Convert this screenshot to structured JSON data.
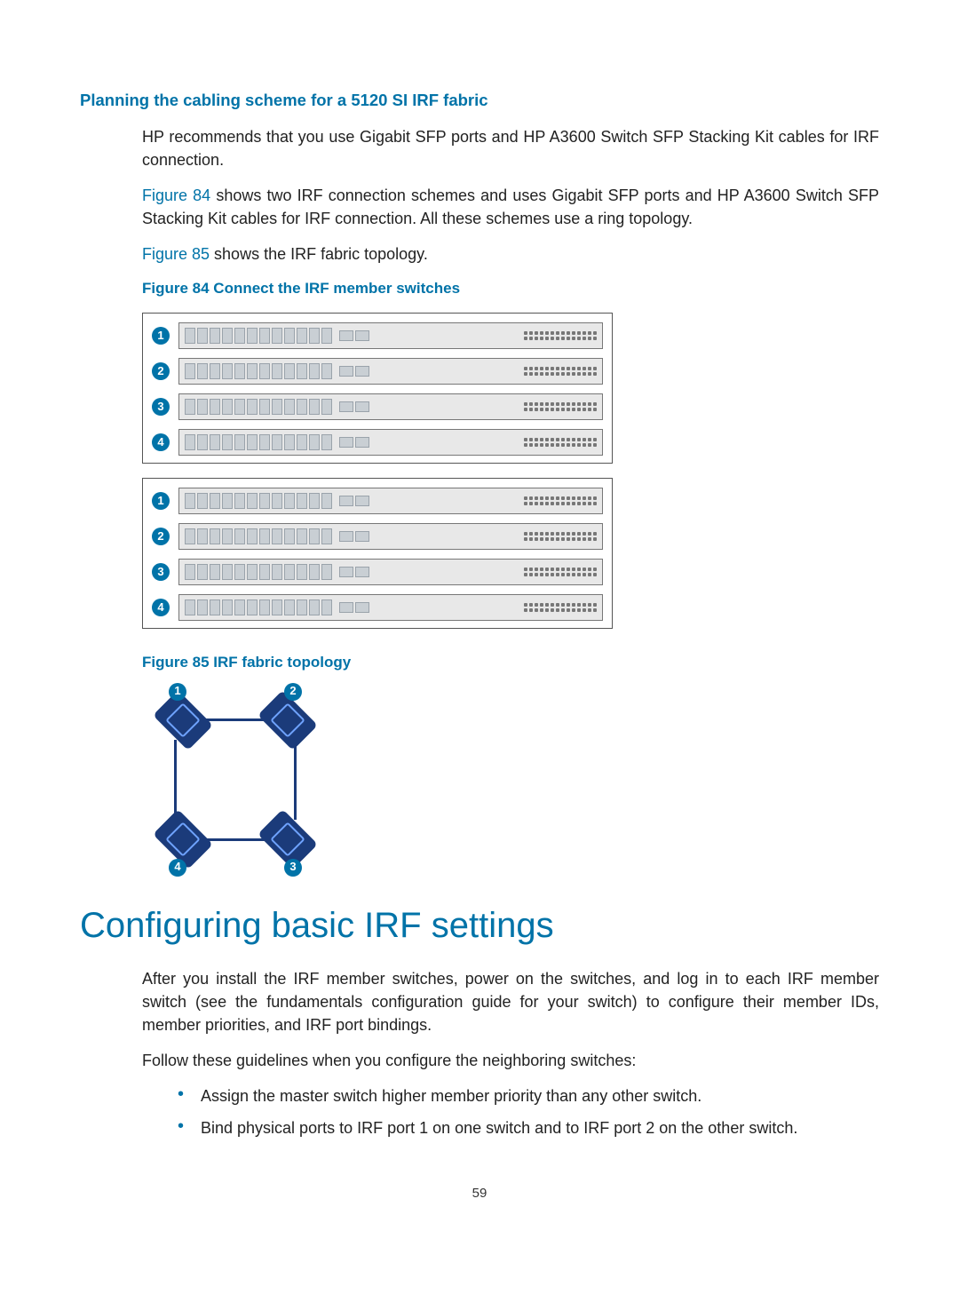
{
  "section": {
    "heading3": "Planning the cabling scheme for a 5120 SI IRF fabric",
    "para1": "HP recommends that you use Gigabit SFP ports and HP A3600 Switch SFP Stacking Kit cables for IRF connection.",
    "para2a": "Figure 84",
    "para2b": " shows two IRF connection schemes and uses Gigabit SFP ports and HP A3600 Switch SFP Stacking Kit cables for IRF connection. All these schemes use a ring topology.",
    "para3a": "Figure 85",
    "para3b": " shows the IRF fabric topology.",
    "fig84_caption": "Figure 84 Connect the IRF member switches",
    "fig84_labels": {
      "g1": [
        "1",
        "2",
        "3",
        "4"
      ],
      "g2": [
        "1",
        "2",
        "3",
        "4"
      ]
    },
    "fig85_caption": "Figure 85 IRF fabric topology",
    "fig85_labels": [
      "1",
      "2",
      "3",
      "4"
    ]
  },
  "section2": {
    "heading2": "Configuring basic IRF settings",
    "para1": "After you install the IRF member switches, power on the switches, and log in to each IRF member switch (see the fundamentals configuration guide for your switch) to configure their member IDs, member priorities, and IRF port bindings.",
    "para2": "Follow these guidelines when you configure the neighboring switches:",
    "bullets": [
      "Assign the master switch higher member priority than any other switch.",
      "Bind physical ports to IRF port 1 on one switch and to IRF port 2 on the other switch."
    ]
  },
  "page_number": "59"
}
